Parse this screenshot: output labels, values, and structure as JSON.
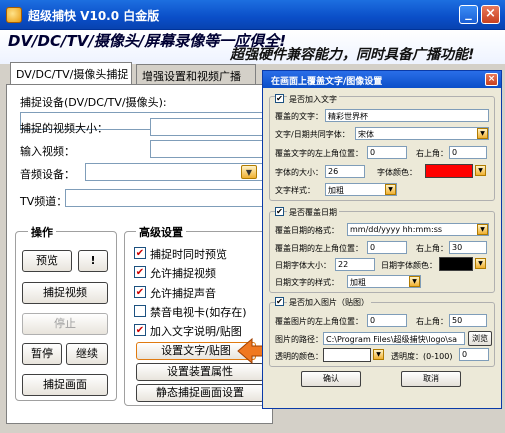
{
  "app": {
    "title": "超级捕快 V10.0 白金版",
    "banner_line1": "DV/DC/TV/摄像头/屏幕录像等一应俱全!",
    "banner_line2": "超强硬件兼容能力，同时具备广播功能!",
    "minimize": "_",
    "close": "×",
    "accent_color": "#0a4ec8"
  },
  "tabs": [
    {
      "label": "DV/DC/TV/摄像头捕捉",
      "active": true
    },
    {
      "label": "增强设置和视频广播",
      "active": false
    }
  ],
  "capture_form": {
    "device_label": "捕捉设备(DV/DC/TV/摄像头):",
    "size_label": "捕捉的视频大小：",
    "input_label": "输入视频：",
    "audio_label": "音频设备：",
    "tv_label": "TV频道："
  },
  "operations": {
    "title": "操作",
    "preview": "预览",
    "help": "!",
    "capture_video": "捕捉视频",
    "stop": "停止",
    "pause": "暂停",
    "resume": "继续",
    "capture_frame": "捕捉画面"
  },
  "advanced": {
    "title": "高级设置",
    "checks": [
      {
        "label": "捕捉时同时预览",
        "checked": true
      },
      {
        "label": "允许捕捉视频",
        "checked": true
      },
      {
        "label": "允许捕捉声音",
        "checked": true
      },
      {
        "label": "禁音电视卡(如存在)",
        "checked": false
      },
      {
        "label": "加入文字说明/贴图",
        "checked": true
      }
    ],
    "btn_text_image": "设置文字/贴图",
    "btn_device": "设置装置属性",
    "btn_static": "静态捕捉画面设置"
  },
  "dialog": {
    "title": "在画面上覆盖文字/图像设置",
    "close": "×",
    "text_section": {
      "enable_label": "是否加入文字",
      "enabled": true,
      "text_label": "覆盖的文字：",
      "text_value": "精彩世界杯",
      "font_label": "文字/日期共同字体：",
      "font_value": "宋体",
      "left_label": "覆盖文字的左上角位置：",
      "left_value": "0",
      "top_label": "右上角：",
      "top_value": "0",
      "size_label": "字体的大小：",
      "size_value": "26",
      "color_label": "字体颜色：",
      "color_value": "#ff0000",
      "style_label": "文字样式：",
      "style_value": "加粗"
    },
    "date_section": {
      "enable_label": "是否覆盖日期",
      "enabled": true,
      "format_label": "覆盖日期的格式：",
      "format_value": "mm/dd/yyyy hh:mm:ss",
      "left_label": "覆盖日期的左上角位置：",
      "left_value": "0",
      "top_label": "右上角：",
      "top_value": "30",
      "size_label": "日期字体大小：",
      "size_value": "22",
      "color_label": "日期字体颜色：",
      "color_value": "#000000",
      "style_label": "日期文字的样式：",
      "style_value": "加粗"
    },
    "image_section": {
      "enable_label": "是否加入图片（贴图）",
      "enabled": true,
      "left_label": "覆盖图片的左上角位置：",
      "left_value": "0",
      "top_label": "右上角：",
      "top_value": "50",
      "path_label": "图片的路径：",
      "path_value": "C:\\Program Files\\超级捕快\\logo\\sa",
      "browse": "浏览",
      "trans_color_label": "透明的颜色：",
      "trans_color_value": "#ffffff",
      "opacity_label": "透明度：(0-100)",
      "opacity_value": "0"
    },
    "ok": "确认",
    "cancel": "取消"
  }
}
